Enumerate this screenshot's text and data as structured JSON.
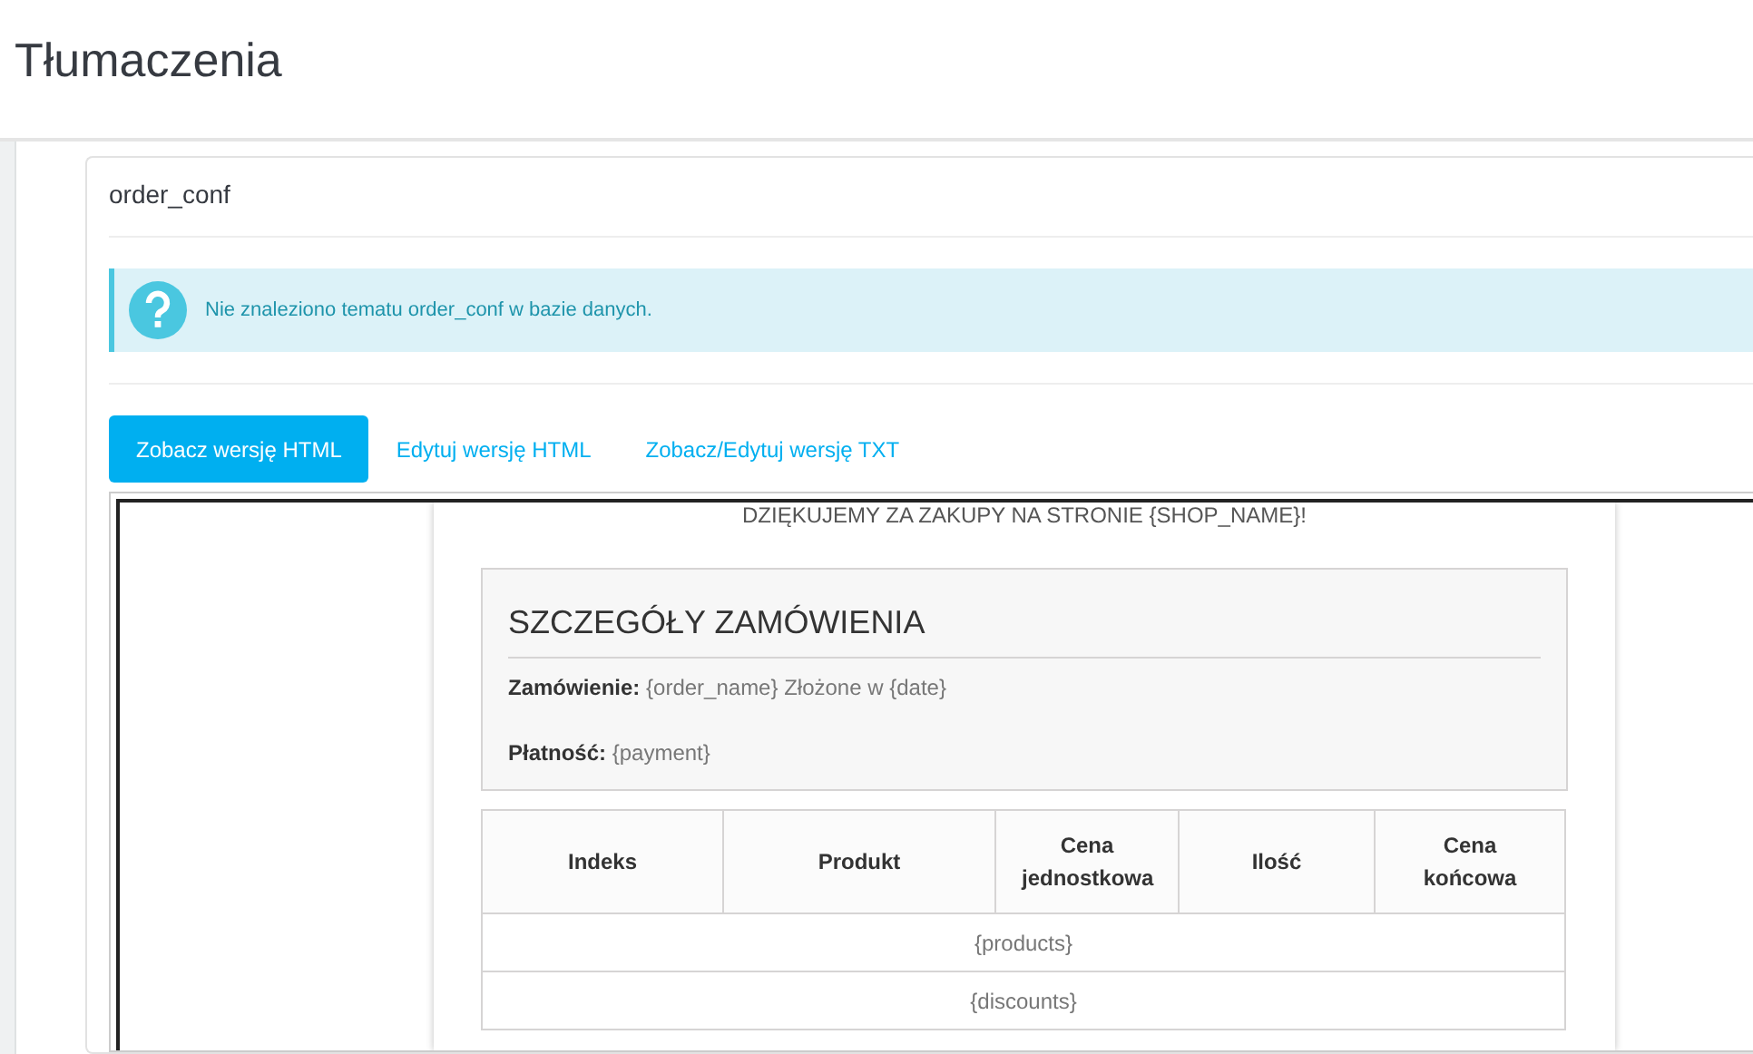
{
  "page_title": "Tłumaczenia",
  "panel": {
    "title": "order_conf",
    "alert": {
      "text": "Nie znaleziono tematu order_conf w bazie danych."
    },
    "tabs": [
      {
        "label": "Zobacz wersję HTML",
        "selected": true
      },
      {
        "label": "Edytuj wersję HTML",
        "selected": false
      },
      {
        "label": "Zobacz/Edytuj wersję TXT",
        "selected": false
      }
    ],
    "preview": {
      "greeting": "DZIĘKUJEMY ZA ZAKUPY NA STRONIE {SHOP_NAME}!",
      "details_title": "SZCZEGÓŁY ZAMÓWIENIA",
      "details": [
        "**Zamówienie:** {order_name} Złożone w {date}",
        "**Płatność:** {payment}"
      ],
      "table": {
        "columns": [
          "Indeks",
          "Produkt",
          "Cena jednostkowa",
          "Ilość",
          "Cena końcowa"
        ],
        "rows": [
          "{products}",
          "{discounts}"
        ]
      }
    }
  }
}
